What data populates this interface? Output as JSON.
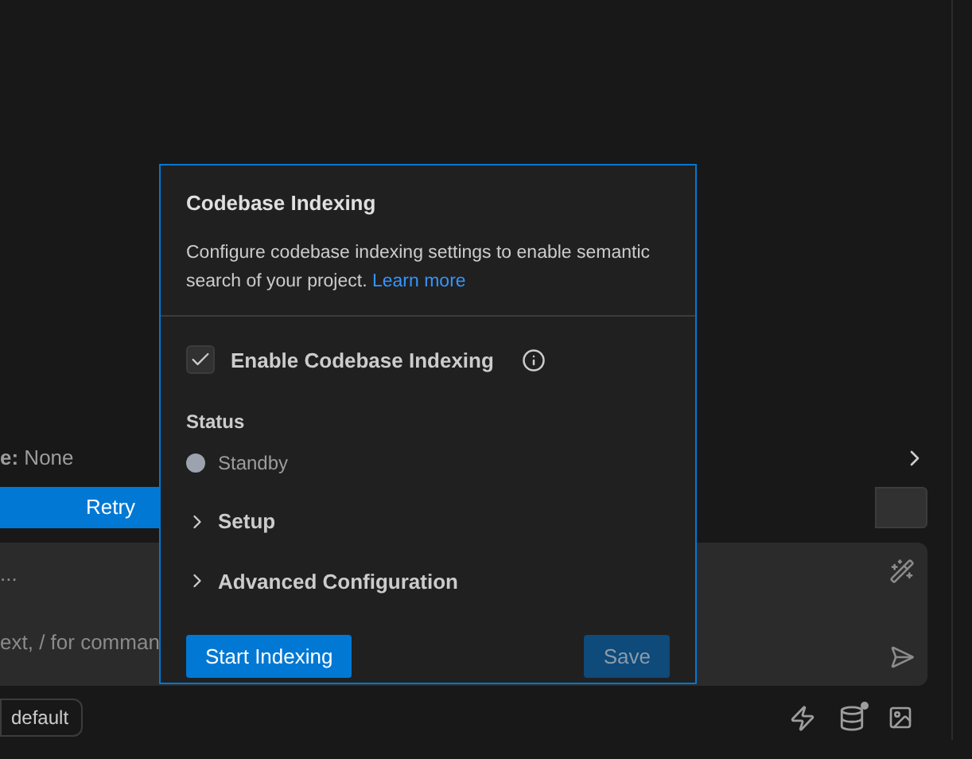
{
  "mode_line": {
    "text": "**e:** None"
  },
  "retry_button": "Retry",
  "input": {
    "text": "...",
    "placeholder": "ext, / for comman"
  },
  "mode_chip": "default",
  "popover": {
    "title": "Codebase Indexing",
    "description": "Configure codebase indexing settings to enable semantic search of your project.",
    "link": "Learn more",
    "enable": {
      "label": "Enable Codebase Indexing",
      "checked": true
    },
    "status_label": "Status",
    "status": {
      "text": "Standby",
      "color": "#9ca3af"
    },
    "sections": [
      {
        "label": "Setup",
        "expanded": false
      },
      {
        "label": "Advanced Configuration",
        "expanded": false
      }
    ],
    "start_button": "Start Indexing",
    "save_button": {
      "label": "Save",
      "disabled": true
    }
  }
}
